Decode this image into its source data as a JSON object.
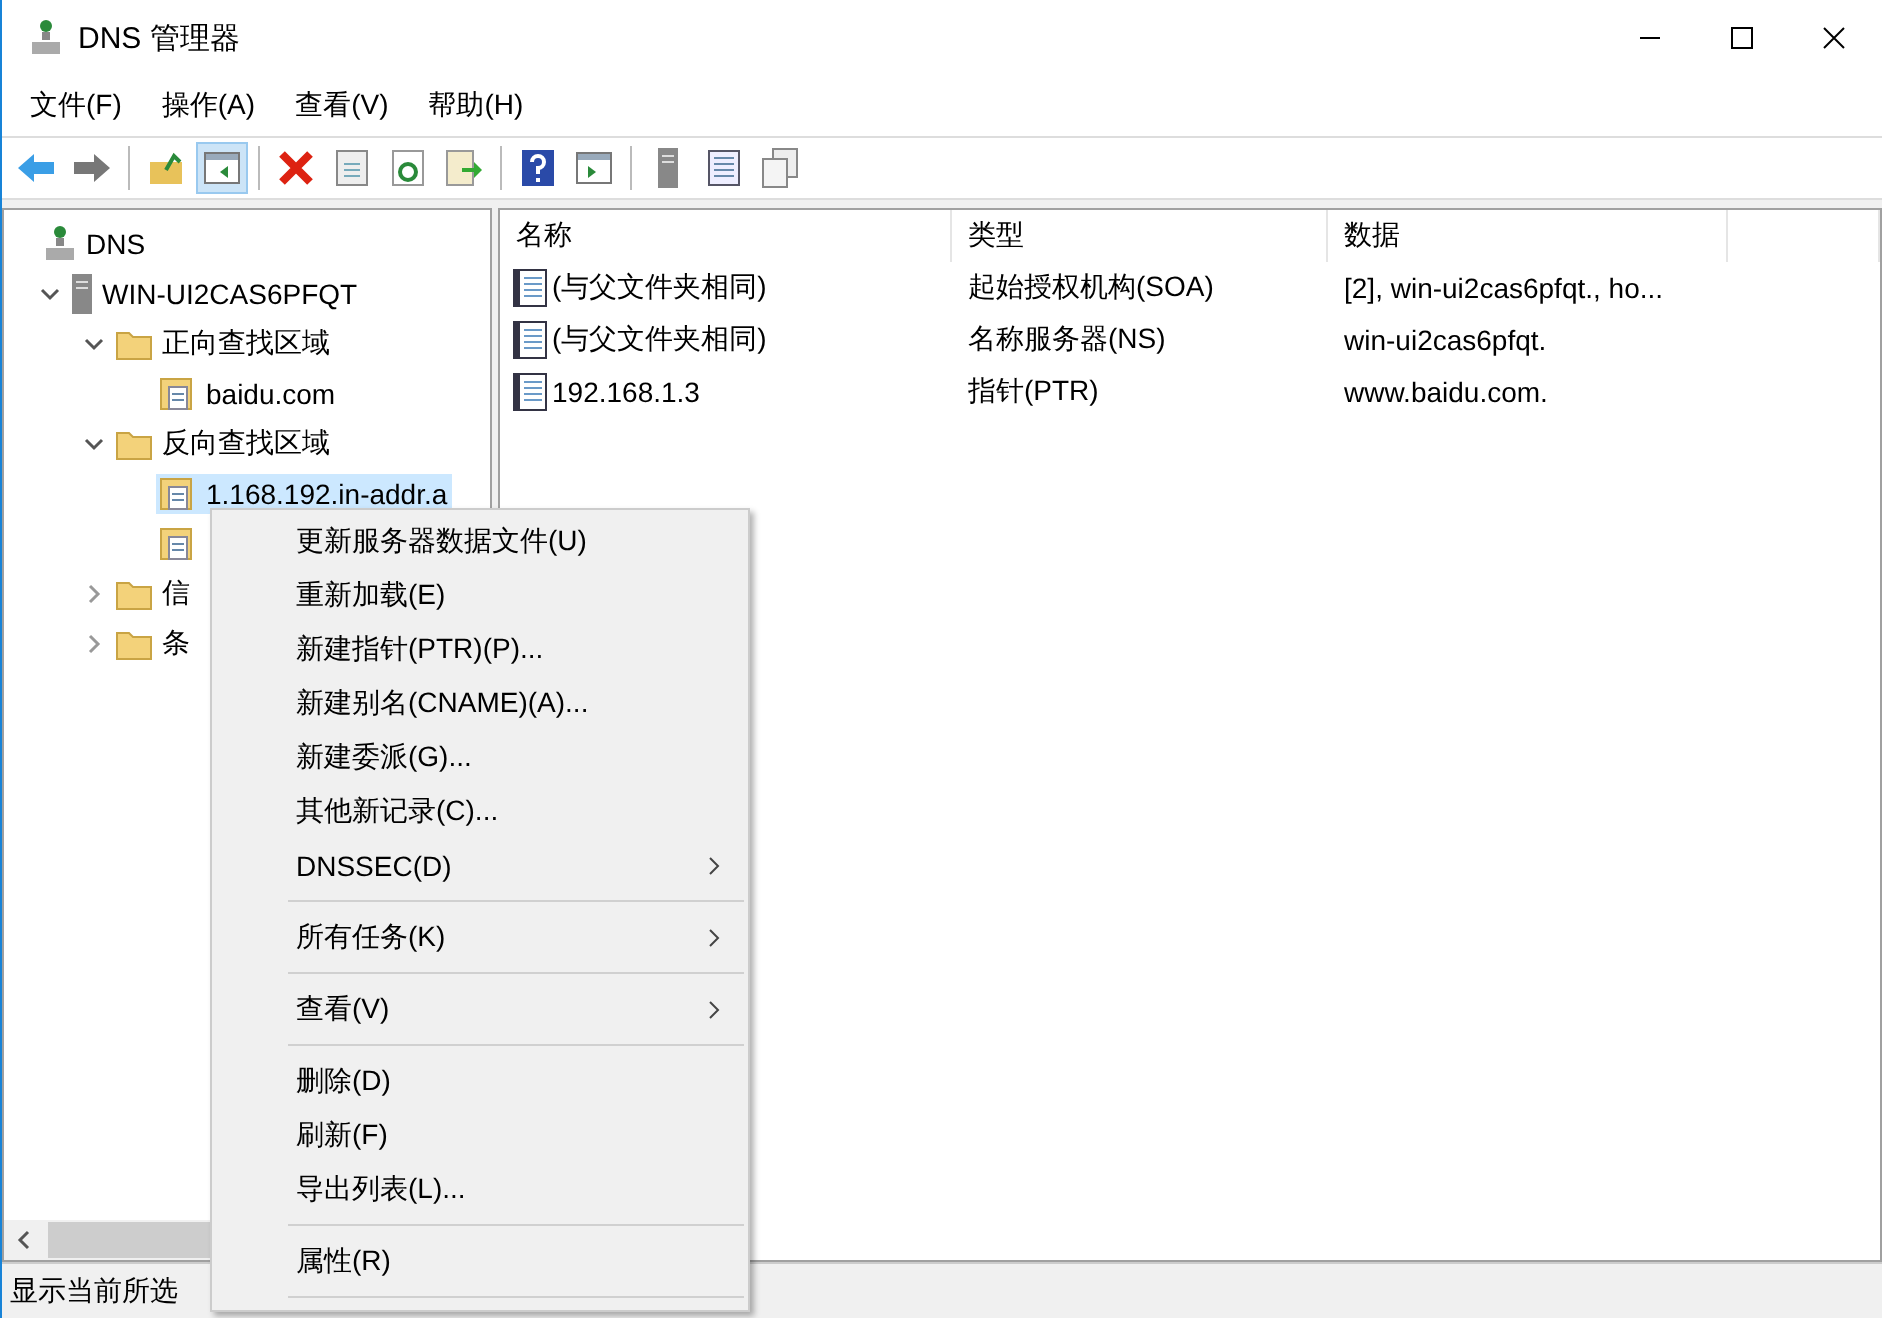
{
  "window": {
    "title": "DNS 管理器"
  },
  "menu_bar": [
    "文件(F)",
    "操作(A)",
    "查看(V)",
    "帮助(H)"
  ],
  "toolbar": [
    {
      "kind": "back"
    },
    {
      "kind": "forward"
    },
    {
      "kind": "sep"
    },
    {
      "kind": "up"
    },
    {
      "kind": "tree",
      "selected": true
    },
    {
      "kind": "sep"
    },
    {
      "kind": "delete"
    },
    {
      "kind": "properties"
    },
    {
      "kind": "refresh"
    },
    {
      "kind": "export"
    },
    {
      "kind": "sep"
    },
    {
      "kind": "help"
    },
    {
      "kind": "panel"
    },
    {
      "kind": "sep"
    },
    {
      "kind": "server"
    },
    {
      "kind": "list"
    },
    {
      "kind": "copy"
    }
  ],
  "tree": [
    {
      "label": "DNS",
      "kind": "root",
      "selected": false,
      "children": [
        {
          "label": "WIN-UI2CAS6PFQT",
          "kind": "server",
          "expanded": true,
          "selected": false,
          "children": [
            {
              "label": "正向查找区域",
              "kind": "folder",
              "expanded": true,
              "selected": false,
              "children": [
                {
                  "label": "baidu.com",
                  "kind": "zone",
                  "selected": false
                }
              ]
            },
            {
              "label": "反向查找区域",
              "kind": "folder",
              "expanded": true,
              "selected": false,
              "children": [
                {
                  "label": "1.168.192.in-addr.a",
                  "kind": "zone",
                  "selected": true
                },
                {
                  "kind": "zone",
                  "selected": false
                }
              ]
            },
            {
              "label": "信",
              "kind": "folder",
              "expanded": false,
              "selected": false
            },
            {
              "label": "条",
              "kind": "folder",
              "expanded": false,
              "selected": false
            }
          ]
        }
      ]
    }
  ],
  "table": {
    "columns": [
      "名称",
      "类型",
      "数据"
    ],
    "rows": [
      [
        "(与父文件夹相同)",
        "起始授权机构(SOA)",
        "[2], win-ui2cas6pfqt., ho..."
      ],
      [
        "(与父文件夹相同)",
        "名称服务器(NS)",
        "win-ui2cas6pfqt."
      ],
      [
        "192.168.1.3",
        "指针(PTR)",
        "www.baidu.com."
      ]
    ]
  },
  "context_menu": [
    {
      "kind": "item",
      "label": "更新服务器数据文件(U)",
      "submenu": false
    },
    {
      "kind": "item",
      "label": "重新加载(E)",
      "submenu": false
    },
    {
      "kind": "item",
      "label": "新建指针(PTR)(P)...",
      "submenu": false
    },
    {
      "kind": "item",
      "label": "新建别名(CNAME)(A)...",
      "submenu": false
    },
    {
      "kind": "item",
      "label": "新建委派(G)...",
      "submenu": false
    },
    {
      "kind": "item",
      "label": "其他新记录(C)...",
      "submenu": false
    },
    {
      "kind": "item",
      "label": "DNSSEC(D)",
      "submenu": true
    },
    {
      "kind": "separator"
    },
    {
      "kind": "item",
      "label": "所有任务(K)",
      "submenu": true
    },
    {
      "kind": "separator"
    },
    {
      "kind": "item",
      "label": "查看(V)",
      "submenu": true
    },
    {
      "kind": "separator"
    },
    {
      "kind": "item",
      "label": "删除(D)",
      "submenu": false
    },
    {
      "kind": "item",
      "label": "刷新(F)",
      "submenu": false
    },
    {
      "kind": "item",
      "label": "导出列表(L)...",
      "submenu": false
    },
    {
      "kind": "separator"
    },
    {
      "kind": "item",
      "label": "属性(R)",
      "submenu": false
    },
    {
      "kind": "separator"
    }
  ],
  "status_bar": "显示当前所选"
}
